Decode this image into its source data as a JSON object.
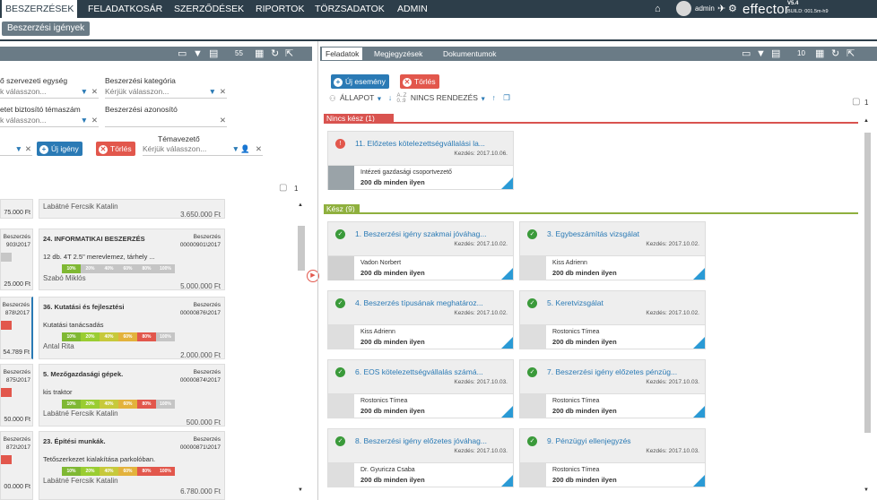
{
  "nav": {
    "items": [
      "BESZERZÉSEK",
      "FELADATKOSÁR",
      "SZERZŐDÉSEK",
      "RIPORTOK",
      "TÖRZSADATOK",
      "ADMIN"
    ],
    "user": "admin",
    "brand": "effector",
    "version": "V5.4",
    "build": "BUILD: 001.5m-h9"
  },
  "subtab": "Beszerzési igények",
  "left": {
    "toolbar_count": "55",
    "filters": {
      "org_unit_label": "ő szervezeti egység",
      "org_unit_value": "k válasszon...",
      "category_label": "Beszerzési kategória",
      "category_value": "Kérjük válasszon...",
      "funding_label": "etet biztosító témaszám",
      "funding_value": "k válasszon...",
      "req_id_label": "Beszerzési azonosító",
      "req_id_value": "",
      "supervisor_label": "Témavezető",
      "supervisor_value": "Kérjük válasszon..."
    },
    "new_btn": "Új igény",
    "delete_btn": "Törlés",
    "list_count": "1",
    "cards": [
      {
        "title": "",
        "category": "",
        "number": "",
        "desc": "",
        "person": "Labátné Fercsik Katalin",
        "amount": "3.650.000 Ft"
      },
      {
        "title": "24. INFORMATIKAI BESZERZÉS",
        "category": "Beszerzés",
        "number": "00000901\\2017",
        "desc": "12 db. 4T 2.5\" merevlemez, tárhely ...",
        "person": "Szabó Miklós",
        "amount": "5.000.000 Ft"
      },
      {
        "title": "36. Kutatási és fejlesztési",
        "category": "Beszerzés",
        "number": "00000876\\2017",
        "desc": "Kutatási tanácsadás",
        "person": "Antal Rita",
        "amount": "2.000.000 Ft"
      },
      {
        "title": "5. Mezőgazdasági gépek.",
        "category": "Beszerzés",
        "number": "00000874\\2017",
        "desc": "kis traktor",
        "person": "Labátné Fercsik Katalin",
        "amount": "500.000 Ft"
      },
      {
        "title": "23. Építési munkák.",
        "category": "Beszerzés",
        "number": "00000871\\2017",
        "desc": "Tetőszerkezet kialakítása parkolóban.",
        "person": "Labátné Fercsik Katalin",
        "amount": "6.780.000 Ft"
      }
    ],
    "stubs": [
      {
        "line1": "75.000 Ft"
      },
      {
        "line1": "Beszerzés",
        "line2": "903\\2017",
        "line3": "25.000 Ft"
      },
      {
        "line1": "Beszerzés",
        "line2": "878\\2017",
        "line3": "54.789 Ft"
      },
      {
        "line1": "Beszerzés",
        "line2": "875\\2017",
        "line3": "50.000 Ft"
      },
      {
        "line1": "Beszerzés",
        "line2": "872\\2017",
        "line3": "00.000 Ft"
      }
    ],
    "progress_steps": [
      "10%",
      "20%",
      "40%",
      "60%",
      "80%",
      "100%"
    ]
  },
  "right": {
    "tabs": [
      "Feladatok",
      "Megjegyzések",
      "Dokumentumok"
    ],
    "toolbar_count": "10",
    "new_event_btn": "Új esemény",
    "delete_btn": "Törlés",
    "sort_state": "ÁLLAPOT",
    "sort_order": "NINCS RENDEZÉS",
    "sort_az": "A..Z",
    "sort_09": "0..9",
    "right_count": "1",
    "section_open": "Nincs kész (1)",
    "section_done": "Kész (9)",
    "open_tasks": [
      {
        "title": "11. Előzetes kötelezettségvállalási la...",
        "date": "Kezdés: 2017.10.06.",
        "person": "Intézeti gazdasági csoportvezető",
        "subject": "200 db minden ilyen"
      }
    ],
    "done_tasks": [
      {
        "title": "1. Beszerzési igény szakmai jóváhag...",
        "date": "Kezdés: 2017.10.02.",
        "person": "Vadon Norbert",
        "subject": "200 db minden ilyen"
      },
      {
        "title": "3. Egybeszámítás vizsgálat",
        "date": "Kezdés: 2017.10.02.",
        "person": "Kiss Adrienn",
        "subject": "200 db minden ilyen"
      },
      {
        "title": "4. Beszerzés típusának meghatároz...",
        "date": "Kezdés: 2017.10.02.",
        "person": "Kiss Adrienn",
        "subject": "200 db minden ilyen"
      },
      {
        "title": "5. Keretvizsgálat",
        "date": "Kezdés: 2017.10.02.",
        "person": "Rostonics Tímea",
        "subject": "200 db minden ilyen"
      },
      {
        "title": "6. EOS kötelezettségvállalás számá...",
        "date": "Kezdés: 2017.10.03.",
        "person": "Rostonics Tímea",
        "subject": "200 db minden ilyen"
      },
      {
        "title": "7. Beszerzési igény előzetes pénzüg...",
        "date": "Kezdés: 2017.10.03.",
        "person": "Rostonics Tímea",
        "subject": "200 db minden ilyen"
      },
      {
        "title": "8. Beszerzési igény előzetes jóváhag...",
        "date": "Kezdés: 2017.10.03.",
        "person": "Dr. Gyuricza Csaba",
        "subject": "200 db minden ilyen"
      },
      {
        "title": "9. Pénzügyi ellenjegyzés",
        "date": "Kezdés: 2017.10.03.",
        "person": "Rostonics Tímea",
        "subject": "200 db minden ilyen"
      }
    ]
  },
  "colors": {
    "nav_bg": "#2d3e4a",
    "toolbar_bg": "#6a7b86",
    "accent_blue": "#2a7ab5",
    "danger_red": "#e2574c",
    "ok_green": "#3a9a3a",
    "section_open": "#d9534f",
    "section_done": "#8fb03e"
  }
}
